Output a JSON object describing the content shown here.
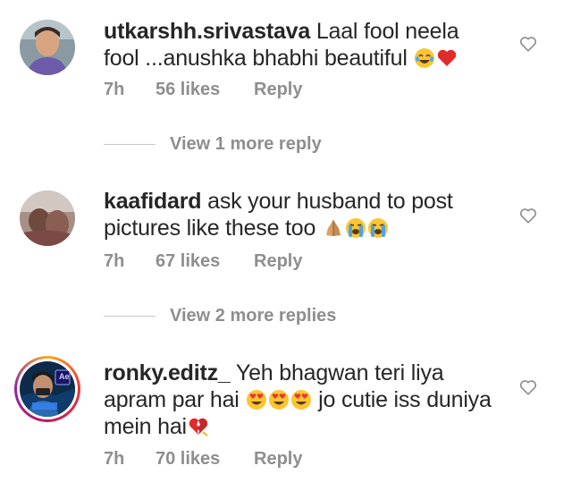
{
  "comments": [
    {
      "username": "utkarshh.srivastava",
      "text": "Laal fool neela fool ...anushka bhabhi beautiful",
      "emojis": [
        "face-with-tears-of-joy",
        "red-heart"
      ],
      "time": "7h",
      "likes": "56 likes",
      "reply": "Reply",
      "more_replies": "View 1 more reply"
    },
    {
      "username": "kaafidard",
      "text": "ask your husband to post pictures like these too",
      "emojis": [
        "folded-hands",
        "loudly-crying-face",
        "loudly-crying-face"
      ],
      "time": "7h",
      "likes": "67 likes",
      "reply": "Reply",
      "more_replies": "View 2 more replies"
    },
    {
      "username": "ronky.editz_",
      "text_part1": "Yeh bhagwan teri liya apram par hai",
      "text_part2": "jo cutie iss duniya mein hai",
      "emojis_part1": [
        "heart-eyes",
        "heart-eyes",
        "heart-eyes"
      ],
      "emojis_part2": [
        "broken-heart"
      ],
      "avatar_overlay": "Ae",
      "time": "7h",
      "likes": "70 likes",
      "reply": "Reply"
    }
  ],
  "colors": {
    "username": "#262626",
    "text": "#262626",
    "meta": "#8e8e8e",
    "story_ring": [
      "#f9a825",
      "#e53935",
      "#c2185b",
      "#8e24aa"
    ]
  }
}
